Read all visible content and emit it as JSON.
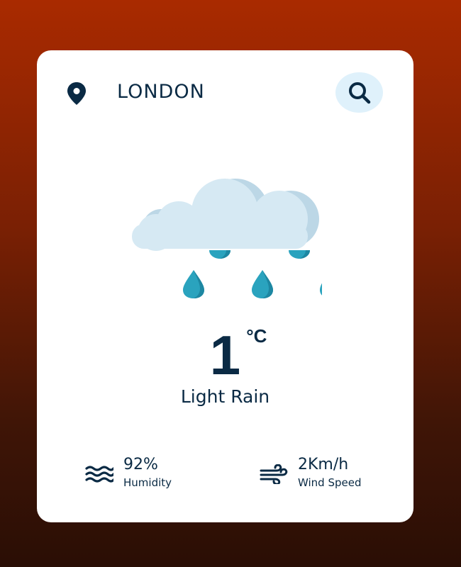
{
  "location": {
    "icon": "map-pin-icon",
    "city": "LONDON"
  },
  "search": {
    "icon": "search-icon"
  },
  "weather": {
    "icon": "rain-cloud-icon",
    "temperature": "1",
    "unit": "°C",
    "condition": "Light Rain"
  },
  "stats": {
    "humidity": {
      "icon": "humidity-waves-icon",
      "value": "92%",
      "label": "Humidity"
    },
    "wind": {
      "icon": "wind-icon",
      "value": "2Km/h",
      "label": "Wind Speed"
    }
  },
  "colors": {
    "primary_text": "#0a2a44",
    "search_bg": "#dff1fb",
    "cloud": "#d6e9f3",
    "cloud_shadow": "#bcd7e6",
    "raindrop": "#2aa3be",
    "background_top": "#a92a00",
    "background_bottom": "#2a0e05"
  }
}
